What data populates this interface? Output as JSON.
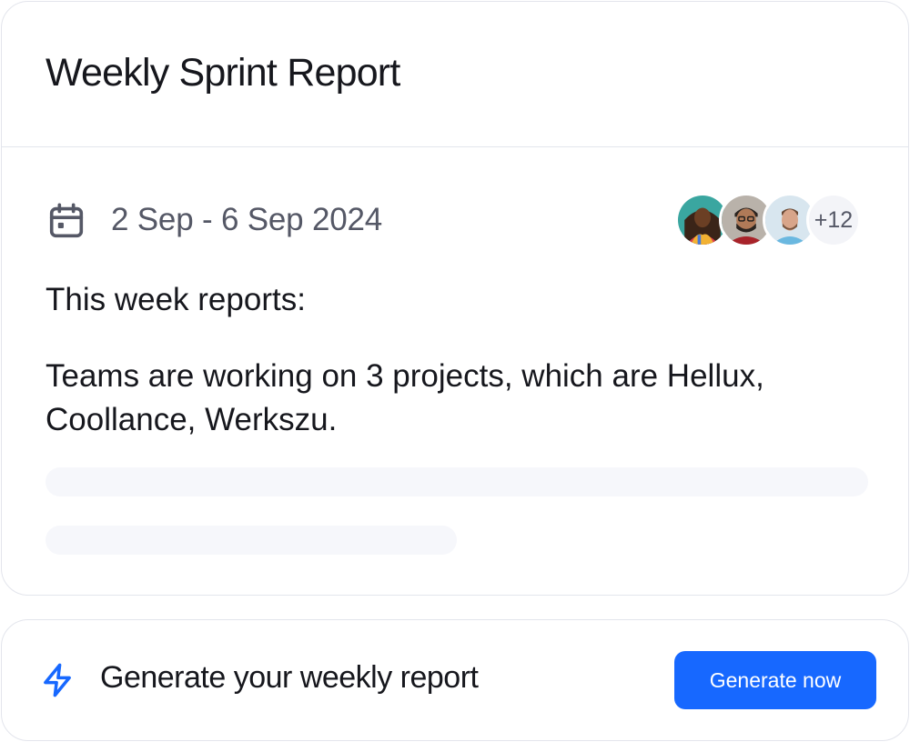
{
  "card": {
    "title": "Weekly Sprint Report",
    "date_range": "2 Sep - 6 Sep 2024",
    "avatars_extra": "+12",
    "intro": "This week reports:",
    "summary": "Teams are working on 3 projects, which are Hellux, Coollance, Werkszu."
  },
  "cta": {
    "text": "Generate your weekly report",
    "button_label": "Generate now"
  },
  "icons": {
    "date": "calendar-icon",
    "cta": "lightning-bolt-icon"
  },
  "colors": {
    "accent": "#1768ff",
    "border": "#e3e5ec",
    "muted_text": "#555866",
    "skeleton": "#f6f7fb"
  }
}
